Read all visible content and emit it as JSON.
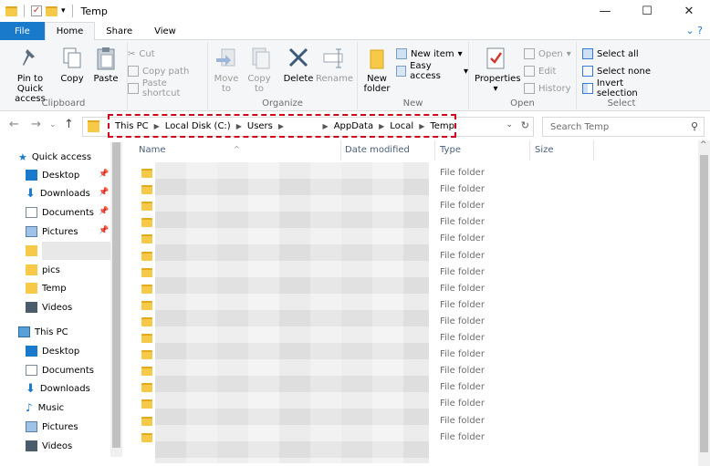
{
  "window": {
    "title": "Temp",
    "minimize": "—",
    "maximize": "☐",
    "close": "✕"
  },
  "tabs": {
    "file": "File",
    "home": "Home",
    "share": "Share",
    "view": "View"
  },
  "ribbon": {
    "clipboard": {
      "label": "Clipboard",
      "pin": "Pin to Quick access",
      "copy": "Copy",
      "paste": "Paste",
      "cut": "Cut",
      "copy_path": "Copy path",
      "paste_shortcut": "Paste shortcut"
    },
    "organize": {
      "label": "Organize",
      "move_to": "Move to",
      "copy_to": "Copy to",
      "delete": "Delete",
      "rename": "Rename"
    },
    "new": {
      "label": "New",
      "new_folder": "New folder",
      "new_item": "New item",
      "easy_access": "Easy access"
    },
    "open": {
      "label": "Open",
      "properties": "Properties",
      "open": "Open",
      "edit": "Edit",
      "history": "History"
    },
    "select": {
      "label": "Select",
      "select_all": "Select all",
      "select_none": "Select none",
      "invert": "Invert selection"
    }
  },
  "address": {
    "crumbs": [
      "This PC",
      "Local Disk (C:)",
      "Users",
      "AppData",
      "Local",
      "Temp"
    ],
    "search_placeholder": "Search Temp"
  },
  "nav": {
    "quick_access": "Quick access",
    "qa_items": [
      "Desktop",
      "Downloads",
      "Documents",
      "Pictures"
    ],
    "other_items": [
      "pics",
      "Temp",
      "Videos"
    ],
    "this_pc": "This PC",
    "pc_items": [
      "Desktop",
      "Documents",
      "Downloads",
      "Music",
      "Pictures",
      "Videos"
    ]
  },
  "columns": {
    "name": "Name",
    "date": "Date modified",
    "type": "Type",
    "size": "Size"
  },
  "rows": [
    "File folder",
    "File folder",
    "File folder",
    "File folder",
    "File folder",
    "File folder",
    "File folder",
    "File folder",
    "File folder",
    "File folder",
    "File folder",
    "File folder",
    "File folder",
    "File folder",
    "File folder",
    "File folder",
    "File folder"
  ]
}
